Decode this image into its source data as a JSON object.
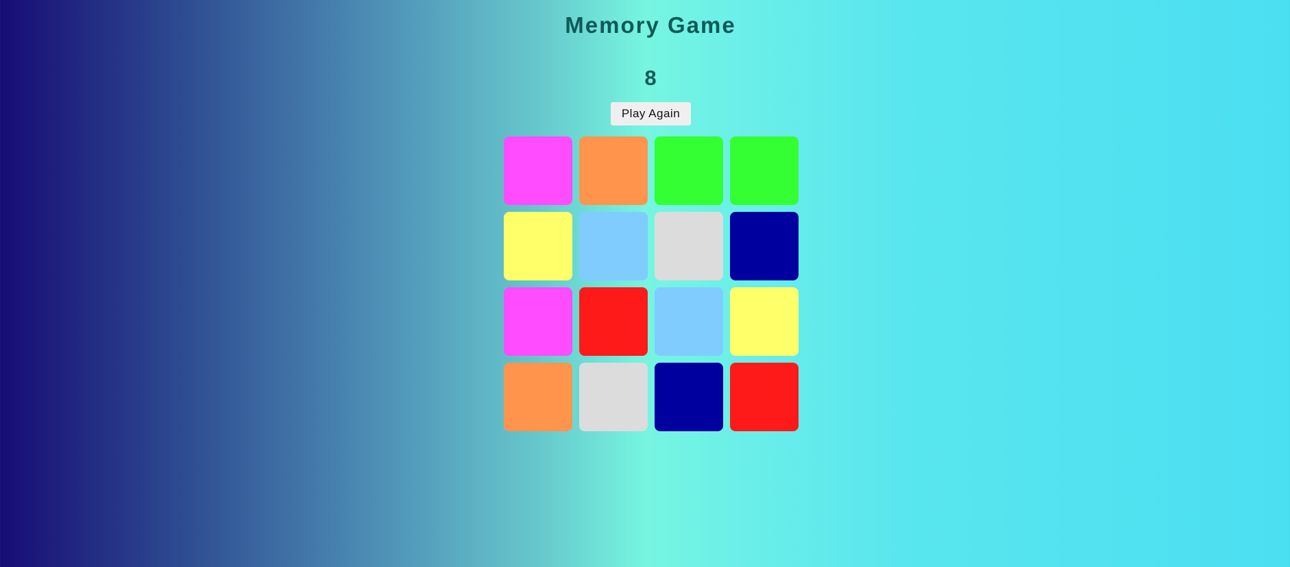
{
  "game": {
    "title": "Memory Game",
    "score": "8",
    "play_again_label": "Play Again"
  },
  "cards": [
    {
      "color": "#ff4cff"
    },
    {
      "color": "#ff944d"
    },
    {
      "color": "#33ff33"
    },
    {
      "color": "#33ff33"
    },
    {
      "color": "#ffff6a"
    },
    {
      "color": "#80ccff"
    },
    {
      "color": "#dcdcdc"
    },
    {
      "color": "#00009f"
    },
    {
      "color": "#ff4cff"
    },
    {
      "color": "#ff1a1a"
    },
    {
      "color": "#80ccff"
    },
    {
      "color": "#ffff6a"
    },
    {
      "color": "#ff944d"
    },
    {
      "color": "#dcdcdc"
    },
    {
      "color": "#00009f"
    },
    {
      "color": "#ff1a1a"
    }
  ]
}
